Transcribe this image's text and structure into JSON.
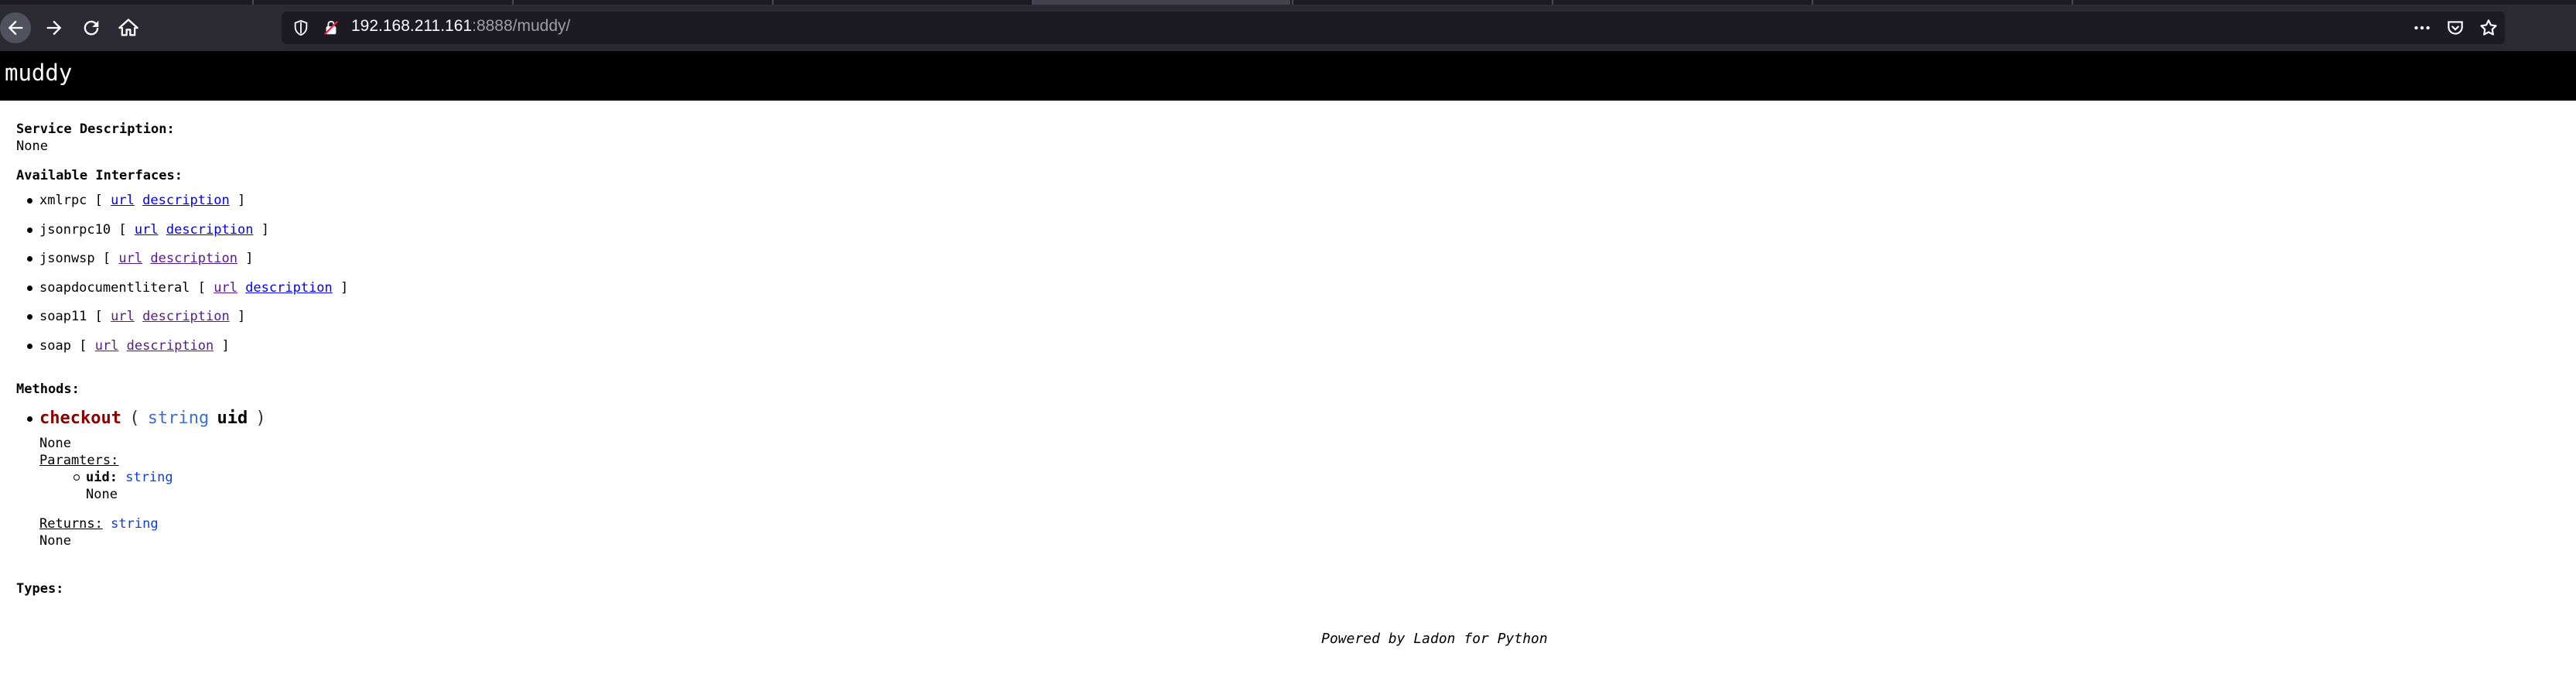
{
  "browser": {
    "url_host": "192.168.211.161",
    "url_rest": ":8888/muddy/"
  },
  "page": {
    "title": "muddy",
    "service_description_label": "Service Description:",
    "service_description_value": "None",
    "interfaces_label": "Available Interfaces:",
    "interfaces": [
      {
        "name": "xmlrpc",
        "open": "[",
        "url": "url",
        "description": "description",
        "close": "]"
      },
      {
        "name": "jsonrpc10",
        "open": "[",
        "url": "url",
        "description": "description",
        "close": "]"
      },
      {
        "name": "jsonwsp",
        "open": "[",
        "url": "url",
        "description": "description",
        "close": "]"
      },
      {
        "name": "soapdocumentliteral",
        "open": "[",
        "url": "url",
        "description": "description",
        "close": "]"
      },
      {
        "name": "soap11",
        "open": "[",
        "url": "url",
        "description": "description",
        "close": "]"
      },
      {
        "name": "soap",
        "open": "[",
        "url": "url",
        "description": "description",
        "close": "]"
      }
    ],
    "methods_label": "Methods:",
    "method": {
      "name": "checkout",
      "open_paren": "(",
      "arg_type": "string",
      "arg_name": "uid",
      "close_paren": ")",
      "doc": "None",
      "params_label": "Paramters:",
      "param_name": "uid",
      "param_colon": ":",
      "param_type": "string",
      "param_doc": "None",
      "returns_label": "Returns:",
      "returns_type": "string",
      "returns_doc": "None"
    },
    "types_label": "Types:",
    "footer": "Powered by Ladon for Python"
  },
  "colors": {
    "link": "#0000ee",
    "visited_link": "#551a8b",
    "method_name": "#8b0000",
    "type": "#3b6fd4",
    "header_bg": "#000000"
  },
  "icons": [
    "back-arrow-icon",
    "forward-arrow-icon",
    "reload-icon",
    "home-icon",
    "shield-icon",
    "insecure-lock-icon",
    "more-icon",
    "pocket-icon",
    "bookmark-star-icon"
  ]
}
